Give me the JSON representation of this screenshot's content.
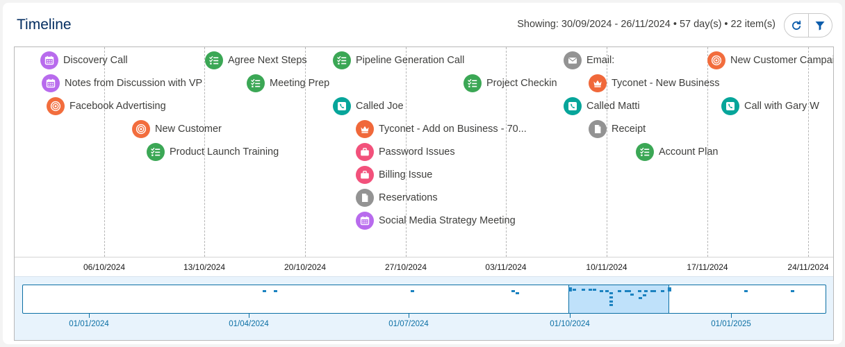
{
  "header": {
    "title": "Timeline",
    "showing": "Showing: 30/09/2024 - 26/11/2024 • 57 day(s) • 22 item(s)",
    "refresh_icon": "refresh-icon",
    "filter_icon": "filter-icon"
  },
  "colors": {
    "event": "#b86bed",
    "task": "#3ba755",
    "campaign": "#f26d3d",
    "call": "#06a59a",
    "email": "#939393",
    "opportunity": "#f0683a",
    "case": "#f2517b",
    "file": "#939393",
    "brush_accent": "#0b6fa4"
  },
  "items": [
    {
      "label": "Discovery Call",
      "type": "event",
      "icon": "calendar-icon"
    },
    {
      "label": "Agree Next Steps",
      "type": "task",
      "icon": "task-checklist-icon"
    },
    {
      "label": "Pipeline Generation Call",
      "type": "task",
      "icon": "task-checklist-icon"
    },
    {
      "label": "Email:",
      "type": "email",
      "icon": "email-icon"
    },
    {
      "label": "New Customer Campai",
      "type": "campaign",
      "icon": "target-icon"
    },
    {
      "label": "Notes from Discussion with VP",
      "type": "event",
      "icon": "calendar-icon"
    },
    {
      "label": "Meeting Prep",
      "type": "task",
      "icon": "task-checklist-icon"
    },
    {
      "label": "Project Checkin",
      "type": "task",
      "icon": "task-checklist-icon"
    },
    {
      "label": "Tyconet - New Business",
      "type": "opportunity",
      "icon": "crown-icon"
    },
    {
      "label": "Facebook Advertising",
      "type": "campaign",
      "icon": "target-icon"
    },
    {
      "label": "Called Joe",
      "type": "call",
      "icon": "phone-icon"
    },
    {
      "label": "Called Matti",
      "type": "call",
      "icon": "phone-icon"
    },
    {
      "label": "Call with Gary W",
      "type": "call",
      "icon": "phone-icon"
    },
    {
      "label": "New Customer",
      "type": "campaign",
      "icon": "target-icon"
    },
    {
      "label": "Tyconet - Add on Business - 70...",
      "type": "opportunity",
      "icon": "crown-icon"
    },
    {
      "label": "Receipt",
      "type": "file",
      "icon": "document-icon"
    },
    {
      "label": "Product Launch Training",
      "type": "task",
      "icon": "task-checklist-icon"
    },
    {
      "label": "Password Issues",
      "type": "case",
      "icon": "briefcase-icon"
    },
    {
      "label": "Account Plan",
      "type": "task",
      "icon": "task-checklist-icon"
    },
    {
      "label": "Billing Issue",
      "type": "case",
      "icon": "briefcase-icon"
    },
    {
      "label": "Reservations",
      "type": "file",
      "icon": "document-icon"
    },
    {
      "label": "Social Media Strategy Meeting",
      "type": "event",
      "icon": "calendar-icon"
    }
  ],
  "axis": {
    "labels": [
      "06/10/2024",
      "13/10/2024",
      "20/10/2024",
      "27/10/2024",
      "03/11/2024",
      "10/11/2024",
      "17/11/2024",
      "24/11/2024"
    ]
  },
  "brush": {
    "labels": [
      "01/01/2024",
      "01/04/2024",
      "01/07/2024",
      "01/10/2024",
      "01/01/2025"
    ]
  }
}
